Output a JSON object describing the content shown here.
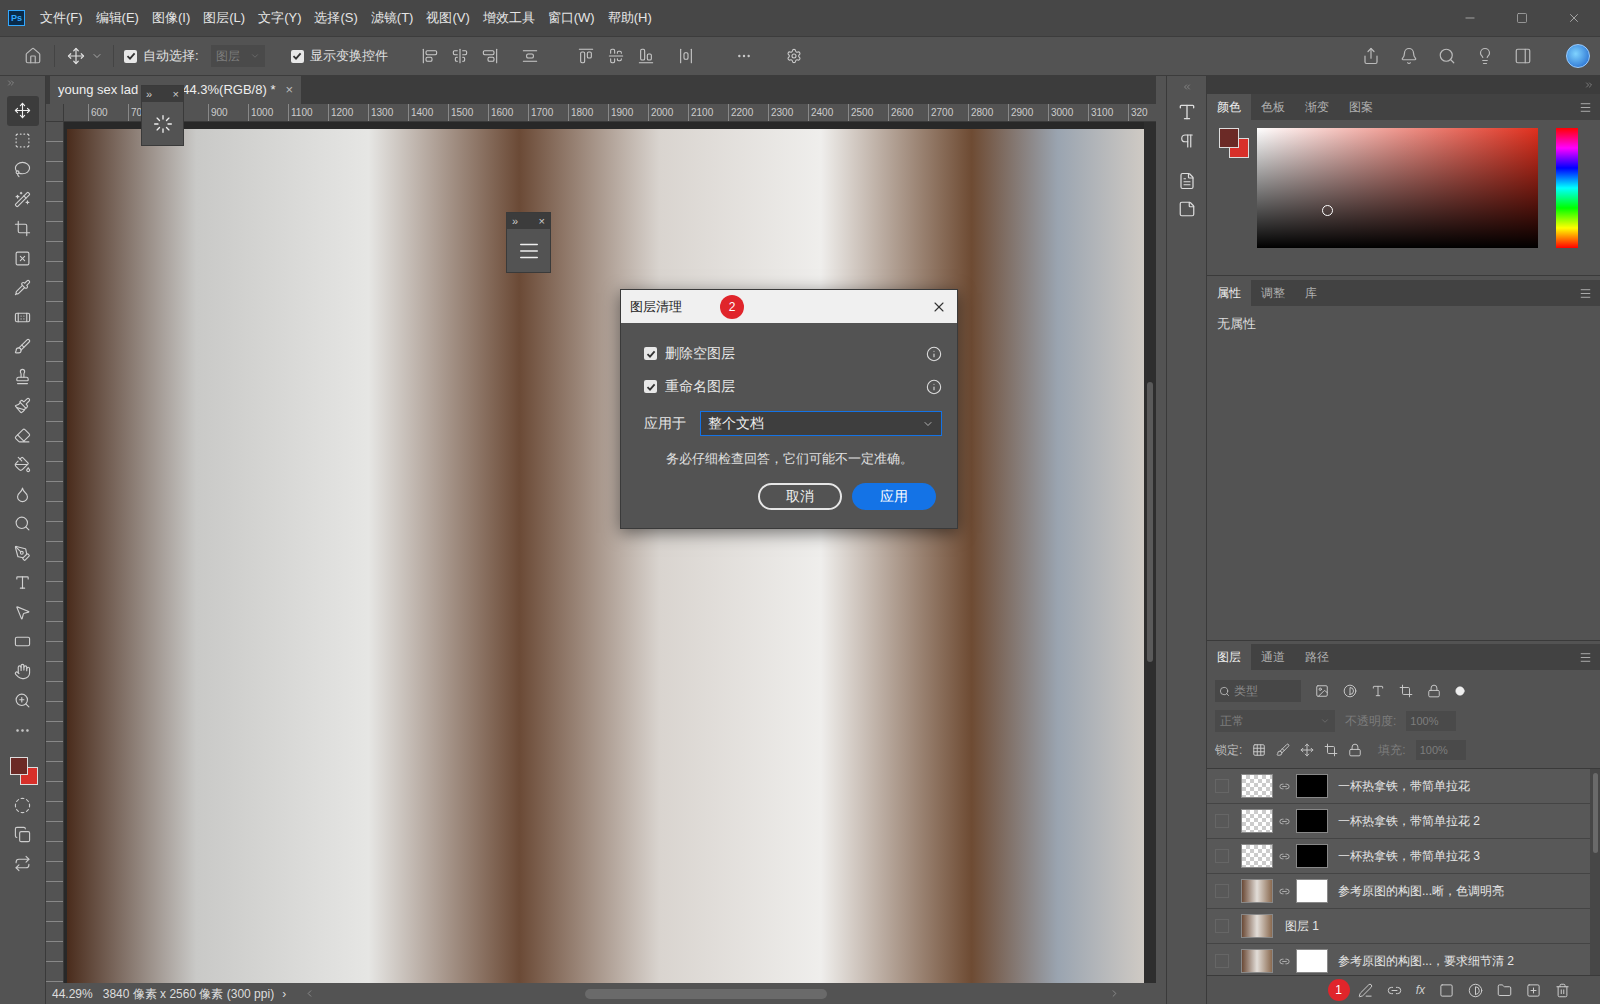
{
  "app": {
    "logo": "Ps"
  },
  "menu": [
    "文件(F)",
    "编辑(E)",
    "图像(I)",
    "图层(L)",
    "文字(Y)",
    "选择(S)",
    "滤镜(T)",
    "视图(V)",
    "增效工具",
    "窗口(W)",
    "帮助(H)"
  ],
  "options_bar": {
    "auto_select": {
      "label": "自动选择:",
      "checked": true
    },
    "target": {
      "value": "图层",
      "disabled": true
    },
    "show_transform": {
      "label": "显示变换控件",
      "checked": true
    }
  },
  "tools": [
    {
      "selected": true
    },
    {
      "selected": false
    },
    {
      "selected": false
    },
    {
      "selected": false
    },
    {
      "selected": false
    },
    {
      "selected": false
    },
    {
      "selected": false
    },
    {
      "selected": false
    },
    {
      "selected": false
    },
    {
      "selected": false
    },
    {
      "selected": false
    },
    {
      "selected": false
    },
    {
      "selected": false
    },
    {
      "selected": false
    },
    {
      "selected": false
    },
    {
      "selected": false
    },
    {
      "selected": false
    },
    {
      "selected": false
    },
    {
      "selected": false
    },
    {
      "selected": false
    },
    {
      "selected": false
    },
    {
      "selected": false
    }
  ],
  "document_tab": {
    "title": "young sex lad",
    "info": "44.3%(RGB/8) *",
    "close": "×",
    "selected": true
  },
  "floating_panels": [
    {
      "expand": "»",
      "close": "×"
    },
    {
      "expand": "»",
      "close": "×"
    }
  ],
  "ruler": [
    "600",
    "70",
    "",
    "900",
    "1000",
    "1100",
    "1200",
    "1300",
    "1400",
    "1500",
    "1600",
    "1700",
    "1800",
    "1900",
    "2000",
    "2100",
    "2200",
    "2300",
    "2400",
    "2500",
    "2600",
    "2700",
    "2800",
    "2900",
    "3000",
    "3100",
    "320"
  ],
  "status_bar": {
    "zoom": "44.29%",
    "size": "3840 像素 x 2560 像素 (300 ppi)",
    "arrow": "›"
  },
  "color_panel": {
    "tabs": [
      {
        "label": "颜色",
        "selected": true
      },
      {
        "label": "色板",
        "selected": false
      },
      {
        "label": "渐变",
        "selected": false
      },
      {
        "label": "图案",
        "selected": false
      }
    ],
    "picker": {
      "x": 0.25,
      "y": 0.68
    },
    "foreground": "#6b2a26",
    "background": "#d8302a"
  },
  "properties_panel": {
    "tabs": [
      {
        "label": "属性",
        "selected": true
      },
      {
        "label": "调整",
        "selected": false
      },
      {
        "label": "库",
        "selected": false
      }
    ],
    "empty": "无属性"
  },
  "layers_panel": {
    "tabs": [
      {
        "label": "图层",
        "selected": true
      },
      {
        "label": "通道",
        "selected": false
      },
      {
        "label": "路径",
        "selected": false
      }
    ],
    "filter": {
      "placeholder": "类型"
    },
    "blend": {
      "value": "正常",
      "disabled": true
    },
    "opacity": {
      "label": "不透明度:",
      "value": "100%",
      "disabled": true
    },
    "lock": {
      "label": "锁定:"
    },
    "fill": {
      "label": "填充:",
      "value": "100%",
      "disabled": true
    },
    "layers": [
      {
        "name": "一杯热拿铁，带简单拉花",
        "visible": false,
        "thumb": "transparent",
        "mask": "black"
      },
      {
        "name": "一杯热拿铁，带简单拉花 2",
        "visible": false,
        "thumb": "transparent",
        "mask": "black"
      },
      {
        "name": "一杯热拿铁，带简单拉花 3",
        "visible": false,
        "thumb": "transparent",
        "mask": "black"
      },
      {
        "name": "参考原图的构图...晰，色调明亮",
        "visible": false,
        "thumb": "photo",
        "mask": "white"
      },
      {
        "name": "图层 1",
        "visible": false,
        "thumb": "photo",
        "mask": "none"
      },
      {
        "name": "参考原图的构图...，要求细节清 2",
        "visible": false,
        "thumb": "photo",
        "mask": "white"
      }
    ],
    "footer": {
      "badge": "1",
      "fx": "fx"
    }
  },
  "dialog": {
    "title": "图层清理",
    "badge": "2",
    "options": [
      {
        "label": "删除空图层",
        "checked": true
      },
      {
        "label": "重命名图层",
        "checked": true
      }
    ],
    "apply_to": {
      "label": "应用于",
      "value": "整个文档"
    },
    "note": "务必仔细检查回答，它们可能不一定准确。",
    "buttons": [
      {
        "label": "取消",
        "kind": "secondary"
      },
      {
        "label": "应用",
        "kind": "primary"
      }
    ]
  }
}
